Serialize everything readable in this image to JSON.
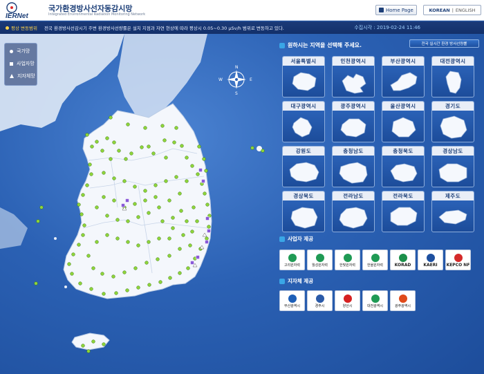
{
  "header": {
    "logo_text": "IERNet",
    "title": "국가환경방사선자동감시망",
    "subtitle": "Integrated Environmental Radiation Monitoring Network",
    "home_button": "Home Page",
    "lang_korean": "KOREAN",
    "lang_sep": "|",
    "lang_english": "ENGLISH"
  },
  "notice": {
    "label": "평상 변동범위",
    "text": "전국 환경방사선감시기 주변 환경방사선량률은 설치 지점과 자연 현상에 따라 평상시 0.05~0.30 μSv/h 범위로 변동하고 있다.",
    "measure_time": "수집시각 : 2019-02-24  11:46"
  },
  "legend": {
    "items": [
      {
        "label": "국가망",
        "shape": "circle"
      },
      {
        "label": "사업자망",
        "shape": "square"
      },
      {
        "label": "지자체망",
        "shape": "triangle"
      }
    ]
  },
  "compass": {
    "n": "N",
    "s": "S",
    "e": "E",
    "w": "W"
  },
  "right_panel": {
    "prompt": "원하시는 지역을 선택해 주세요.",
    "nationwide_button": "전국 실시간 환경 방사선량률",
    "regions": [
      "서울특별시",
      "인천광역시",
      "부산광역시",
      "대전광역시",
      "대구광역시",
      "광주광역시",
      "울산광역시",
      "경기도",
      "강원도",
      "충청남도",
      "충청북도",
      "경상남도",
      "경상북도",
      "전라남도",
      "전라북도",
      "제주도"
    ],
    "operator_title": "사업자 제공",
    "operators": [
      {
        "name": "고리원자력",
        "icon": "khnp-icon",
        "color": "#1f9a54"
      },
      {
        "name": "월성원자력",
        "icon": "khnp-icon",
        "color": "#1f9a54"
      },
      {
        "name": "한빛원자력",
        "icon": "khnp-icon",
        "color": "#1f9a54"
      },
      {
        "name": "한울원자력",
        "icon": "khnp-icon",
        "color": "#1f9a54"
      },
      {
        "name": "KORAD",
        "icon": "korad-icon",
        "color": "#1b8f4a"
      },
      {
        "name": "KAERI",
        "icon": "kaeri-icon",
        "color": "#1d4f9f"
      },
      {
        "name": "KEPCO NF",
        "icon": "kepco-icon",
        "color": "#d42a2a"
      }
    ],
    "local_title": "지자체 제공",
    "locals": [
      {
        "name": "부산광역시",
        "icon": "busan-icon",
        "color": "#1d5fb8"
      },
      {
        "name": "경주시",
        "icon": "gyeongju-icon",
        "color": "#2a5aa8"
      },
      {
        "name": "양산시",
        "icon": "yangsan-icon",
        "color": "#d62020"
      },
      {
        "name": "대전광역시",
        "icon": "daejeon-icon",
        "color": "#1f9a54"
      },
      {
        "name": "광주광역시",
        "icon": "gwangju-icon",
        "color": "#e04a1a"
      }
    ]
  },
  "colors": {
    "national": "#8ed43a",
    "operator": "#8a5ad8",
    "local": "#ffffff"
  }
}
